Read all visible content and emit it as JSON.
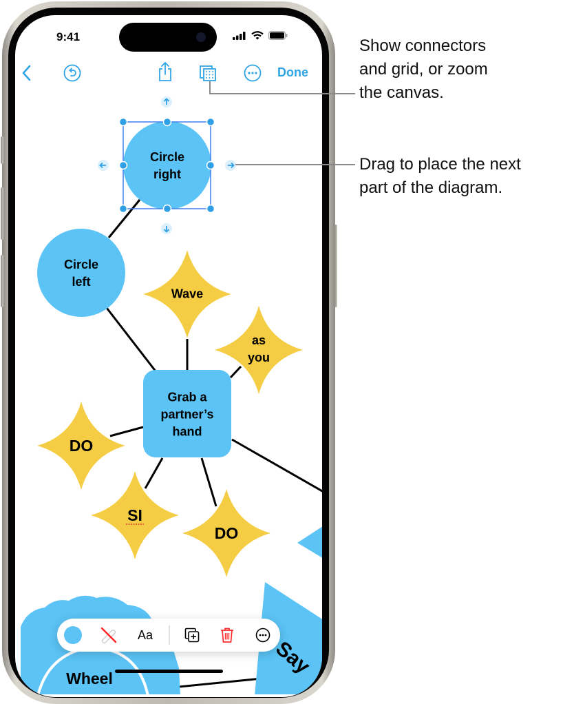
{
  "status_bar": {
    "time": "9:41"
  },
  "toolbar": {
    "back_icon": "chevron-left-icon",
    "undo_icon": "undo-circle-icon",
    "share_icon": "share-icon",
    "view_options_icon": "connectors-grid-icon",
    "more_icon": "ellipsis-circle-icon",
    "done_label": "Done"
  },
  "colors": {
    "accent": "#2fa5e6",
    "shape_blue": "#5bc3f5",
    "shape_yellow": "#f5cd45",
    "selection": "#3f7ff0",
    "delete_red": "#ff2d2d"
  },
  "diagram": {
    "shapes": [
      {
        "id": "circle-right",
        "type": "circle",
        "text": "Circle right",
        "lines": [
          "Circle",
          "right"
        ],
        "selected": true
      },
      {
        "id": "circle-left",
        "type": "circle",
        "text": "Circle left",
        "lines": [
          "Circle",
          "left"
        ]
      },
      {
        "id": "wave",
        "type": "star",
        "text": "Wave",
        "lines": [
          "Wave"
        ]
      },
      {
        "id": "as-you",
        "type": "star",
        "text": "as you",
        "lines": [
          "as",
          "you"
        ]
      },
      {
        "id": "grab-hand",
        "type": "rounded-rect",
        "text": "Grab a partner’s hand",
        "lines": [
          "Grab a",
          "partner’s",
          "hand"
        ]
      },
      {
        "id": "do-left",
        "type": "star",
        "text": "DO",
        "lines": [
          "DO"
        ]
      },
      {
        "id": "si",
        "type": "star",
        "text": "SI",
        "lines": [
          "SI"
        ],
        "spellcheck_flag": true
      },
      {
        "id": "do-bottom",
        "type": "star",
        "text": "DO",
        "lines": [
          "DO"
        ]
      },
      {
        "id": "wheel",
        "type": "cloud",
        "text": "Wheel",
        "lines": [
          "Wheel"
        ]
      },
      {
        "id": "say",
        "type": "triangle",
        "text": "Say",
        "lines": [
          "Say"
        ]
      }
    ],
    "add_next_arrows": [
      "up",
      "down",
      "left",
      "right"
    ]
  },
  "floating_toolbar": {
    "fill_icon": "fill-color-icon",
    "stroke_icon": "no-stroke-icon",
    "text_style_label": "Aa",
    "duplicate_icon": "duplicate-icon",
    "delete_icon": "trash-icon",
    "more_icon": "ellipsis-circle-icon"
  },
  "callouts": [
    {
      "lines": [
        "Show connectors",
        "and grid, or zoom",
        "the canvas."
      ]
    },
    {
      "lines": [
        "Drag to place the next",
        "part of the diagram."
      ]
    }
  ]
}
